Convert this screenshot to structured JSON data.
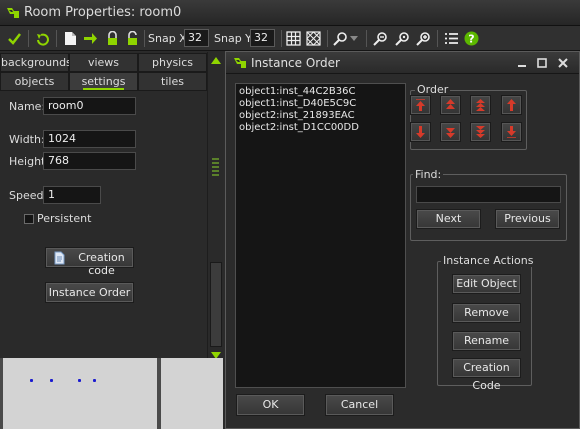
{
  "window": {
    "title": "Room Properties: room0"
  },
  "toolbar": {
    "snap_x_label": "Snap X:",
    "snap_x_value": "32",
    "snap_y_label": "Snap Y:",
    "snap_y_value": "32"
  },
  "tabs": {
    "row1": [
      "backgrounds",
      "views",
      "physics"
    ],
    "row2": [
      "objects",
      "settings",
      "tiles"
    ],
    "active": "settings"
  },
  "settings": {
    "name_label": "Name:",
    "name_value": "room0",
    "width_label": "Width:",
    "width_value": "1024",
    "height_label": "Height:",
    "height_value": "768",
    "speed_label": "Speed:",
    "speed_value": "1",
    "persistent_label": "Persistent",
    "persistent_checked": false,
    "creation_code_label": "Creation code",
    "instance_order_label": "Instance Order"
  },
  "dialog": {
    "title": "Instance Order",
    "instances": [
      "object1:inst_44C2B36C",
      "object1:inst_D40E5C9C",
      "object2:inst_21893EAC",
      "object2:inst_D1CC00DD"
    ],
    "order_label": "Order",
    "find_label": "Find:",
    "find_value": "",
    "next_label": "Next",
    "previous_label": "Previous",
    "actions_label": "Instance Actions",
    "edit_object_label": "Edit Object",
    "remove_label": "Remove",
    "rename_label": "Rename",
    "creation_code_label": "Creation Code",
    "ok_label": "OK",
    "cancel_label": "Cancel"
  },
  "colors": {
    "accent_green": "#8fd400",
    "arrow_red": "#d63a2a",
    "help_green": "#5cb800",
    "instance_dot_blue": "#1a1ad0"
  }
}
